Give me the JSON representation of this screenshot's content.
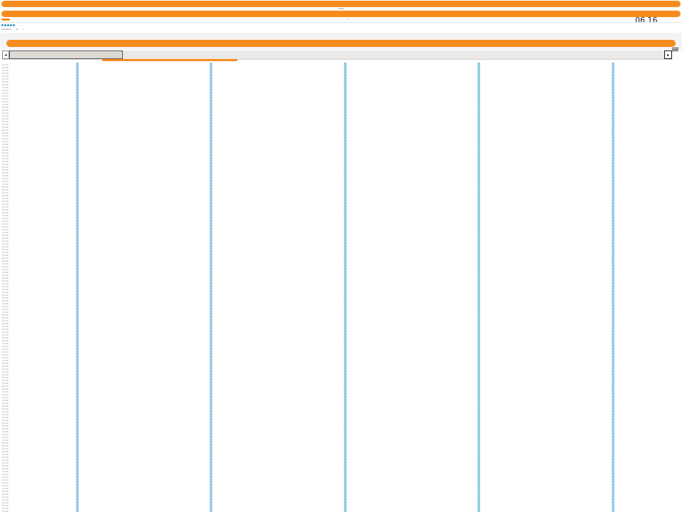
{
  "header": {
    "top_label": "Close",
    "small_mark": "^",
    "time": "06 16"
  },
  "toolbar": {
    "dot_count": 5,
    "sub_items": [
      "Schedule",
      "All",
      "+"
    ],
    "right_mini": "...",
    "menu_icon": "hamburger-icon"
  },
  "scrollbar": {
    "left_arrow": "◂",
    "right_arrow": "▸"
  },
  "grid": {
    "row_count": 158,
    "row_label": "00:00",
    "column_count": 5
  },
  "colors": {
    "accent": "#f68b1f",
    "dot": "#2f9bc9",
    "panel": "#f5f4f5"
  }
}
